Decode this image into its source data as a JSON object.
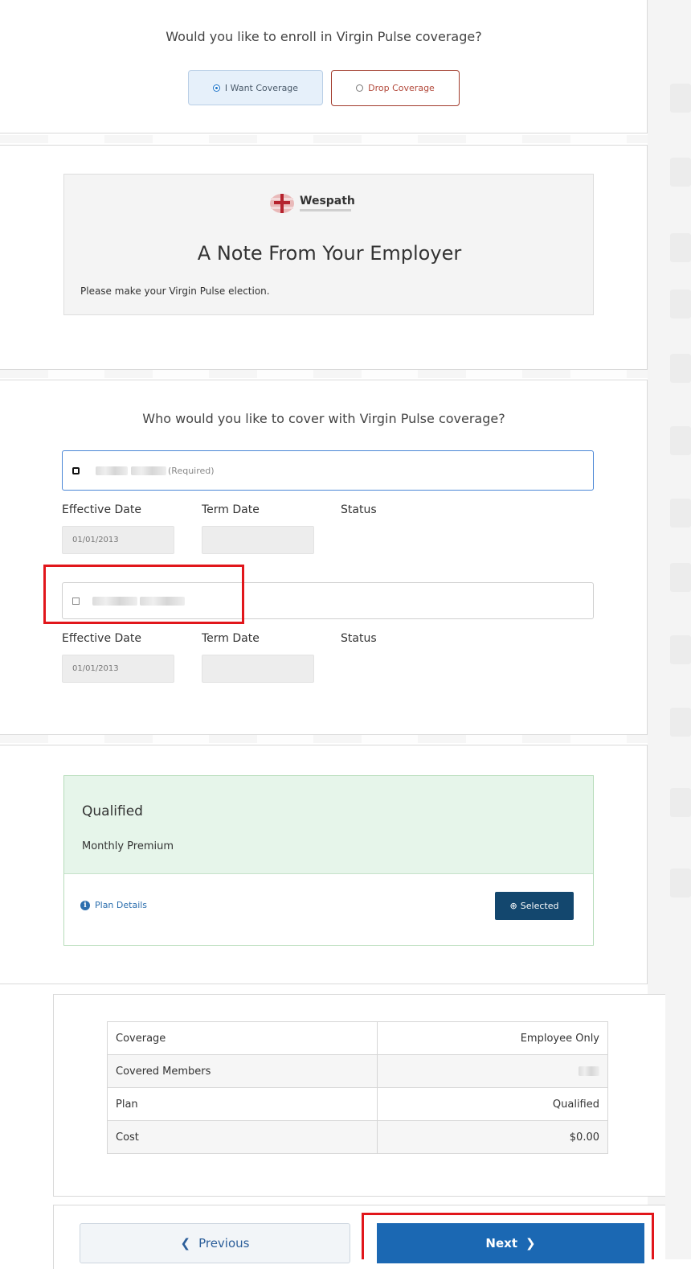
{
  "enroll": {
    "question": "Would you like to enroll in Virgin Pulse coverage?",
    "want_label": "I Want Coverage",
    "drop_label": "Drop Coverage"
  },
  "note": {
    "logo_text": "Wespath",
    "title": "A Note From Your Employer",
    "text": "Please make your Virgin Pulse election."
  },
  "cover": {
    "question": "Who would you like to cover with Virgin Pulse coverage?",
    "members": [
      {
        "required_label": "(Required)",
        "effective_label": "Effective Date",
        "term_label": "Term Date",
        "status_label": "Status",
        "effective_value": "01/01/2013"
      },
      {
        "effective_label": "Effective Date",
        "term_label": "Term Date",
        "status_label": "Status",
        "effective_value": "01/01/2013"
      }
    ]
  },
  "plan": {
    "name": "Qualified",
    "premium_label": "Monthly Premium",
    "details_link": "Plan Details",
    "selected_label": "Selected"
  },
  "summary": {
    "rows": [
      {
        "label": "Coverage",
        "value": "Employee Only"
      },
      {
        "label": "Covered Members",
        "value": ""
      },
      {
        "label": "Plan",
        "value": "Qualified"
      },
      {
        "label": "Cost",
        "value": "$0.00"
      }
    ]
  },
  "nav": {
    "previous": "Previous",
    "next": "Next"
  },
  "colors": {
    "primary": "#1b68b3",
    "drop": "#a23b2c",
    "highlight": "#e1161b",
    "plan_bg": "#e6f5ea"
  }
}
